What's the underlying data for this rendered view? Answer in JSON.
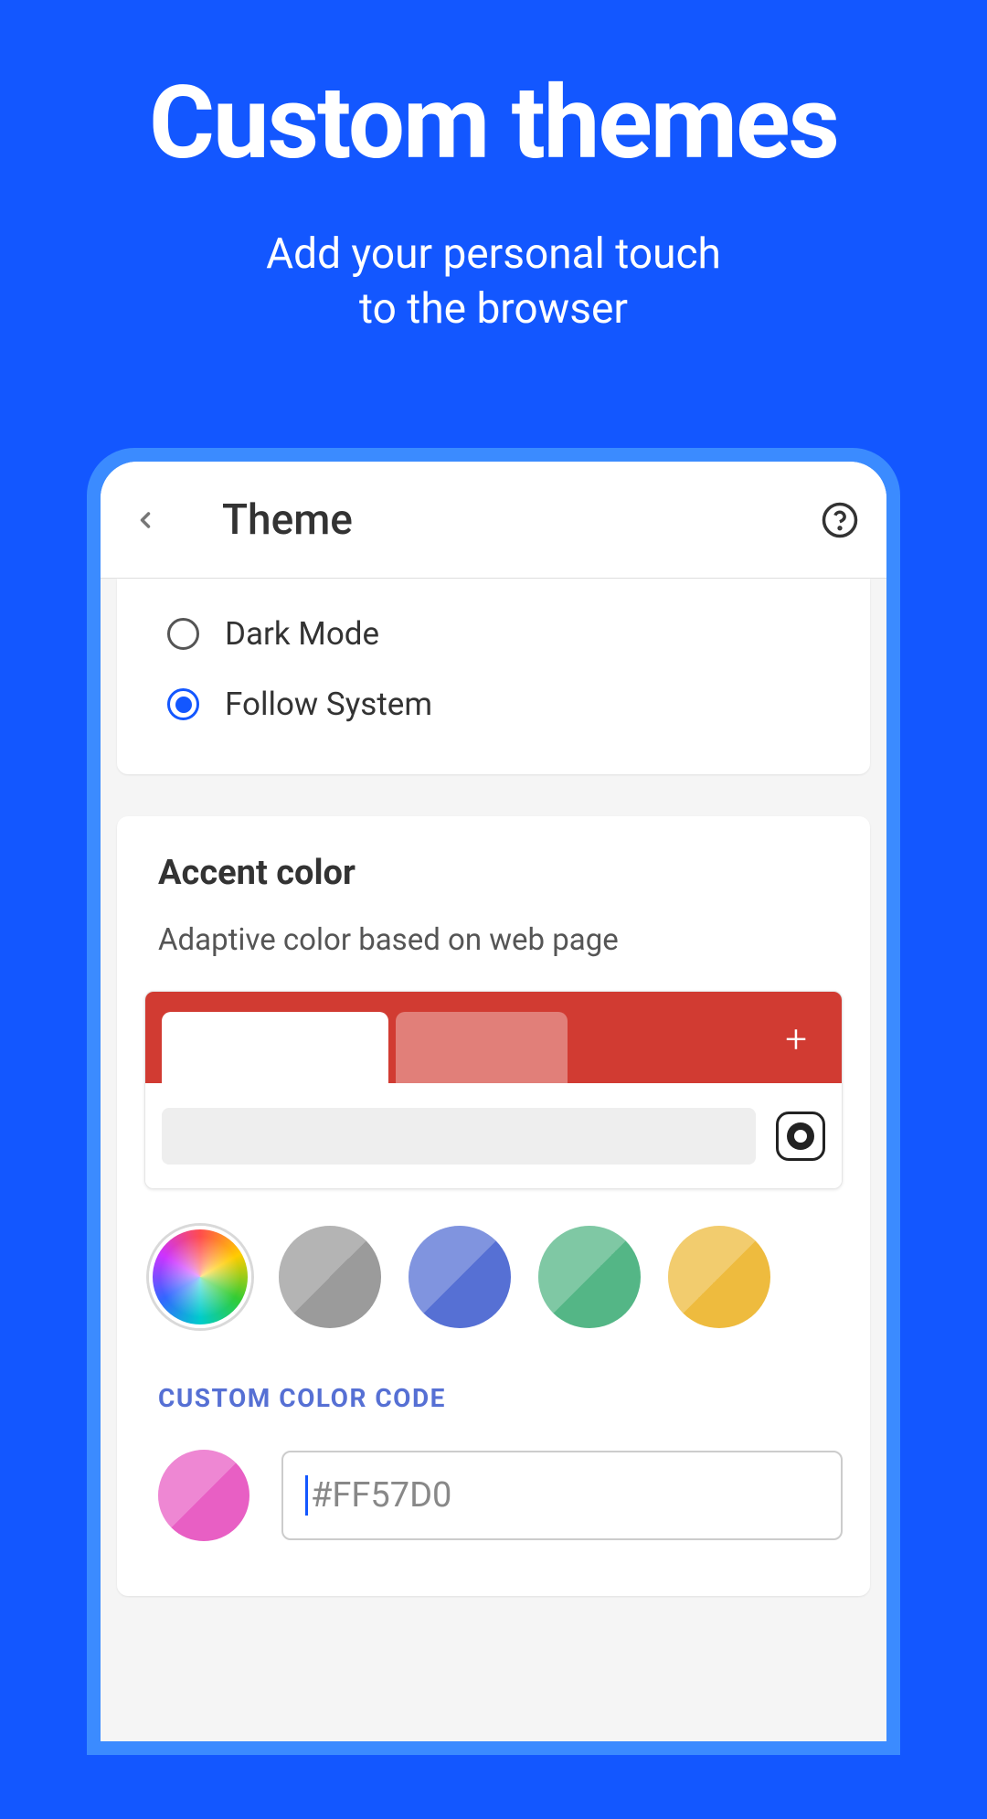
{
  "hero": {
    "title": "Custom themes",
    "subtitle_line1": "Add your personal touch",
    "subtitle_line2": "to the browser"
  },
  "header": {
    "title": "Theme"
  },
  "appearance": {
    "options": [
      {
        "label": "Dark Mode",
        "selected": false
      },
      {
        "label": "Follow System",
        "selected": true
      }
    ]
  },
  "accent": {
    "title": "Accent color",
    "description": "Adaptive color based on web page",
    "preview_accent": "#D13B32",
    "swatches": [
      {
        "name": "adaptive-rainbow",
        "color": "rainbow"
      },
      {
        "name": "gray",
        "color": "#9B9B9B"
      },
      {
        "name": "blue",
        "color": "#5670D4"
      },
      {
        "name": "green",
        "color": "#54B686"
      },
      {
        "name": "yellow",
        "color": "#EEBB3E"
      }
    ]
  },
  "custom": {
    "label": "CUSTOM COLOR CODE",
    "swatch_color": "#E85FC4",
    "hex_value": "#FF57D0"
  }
}
